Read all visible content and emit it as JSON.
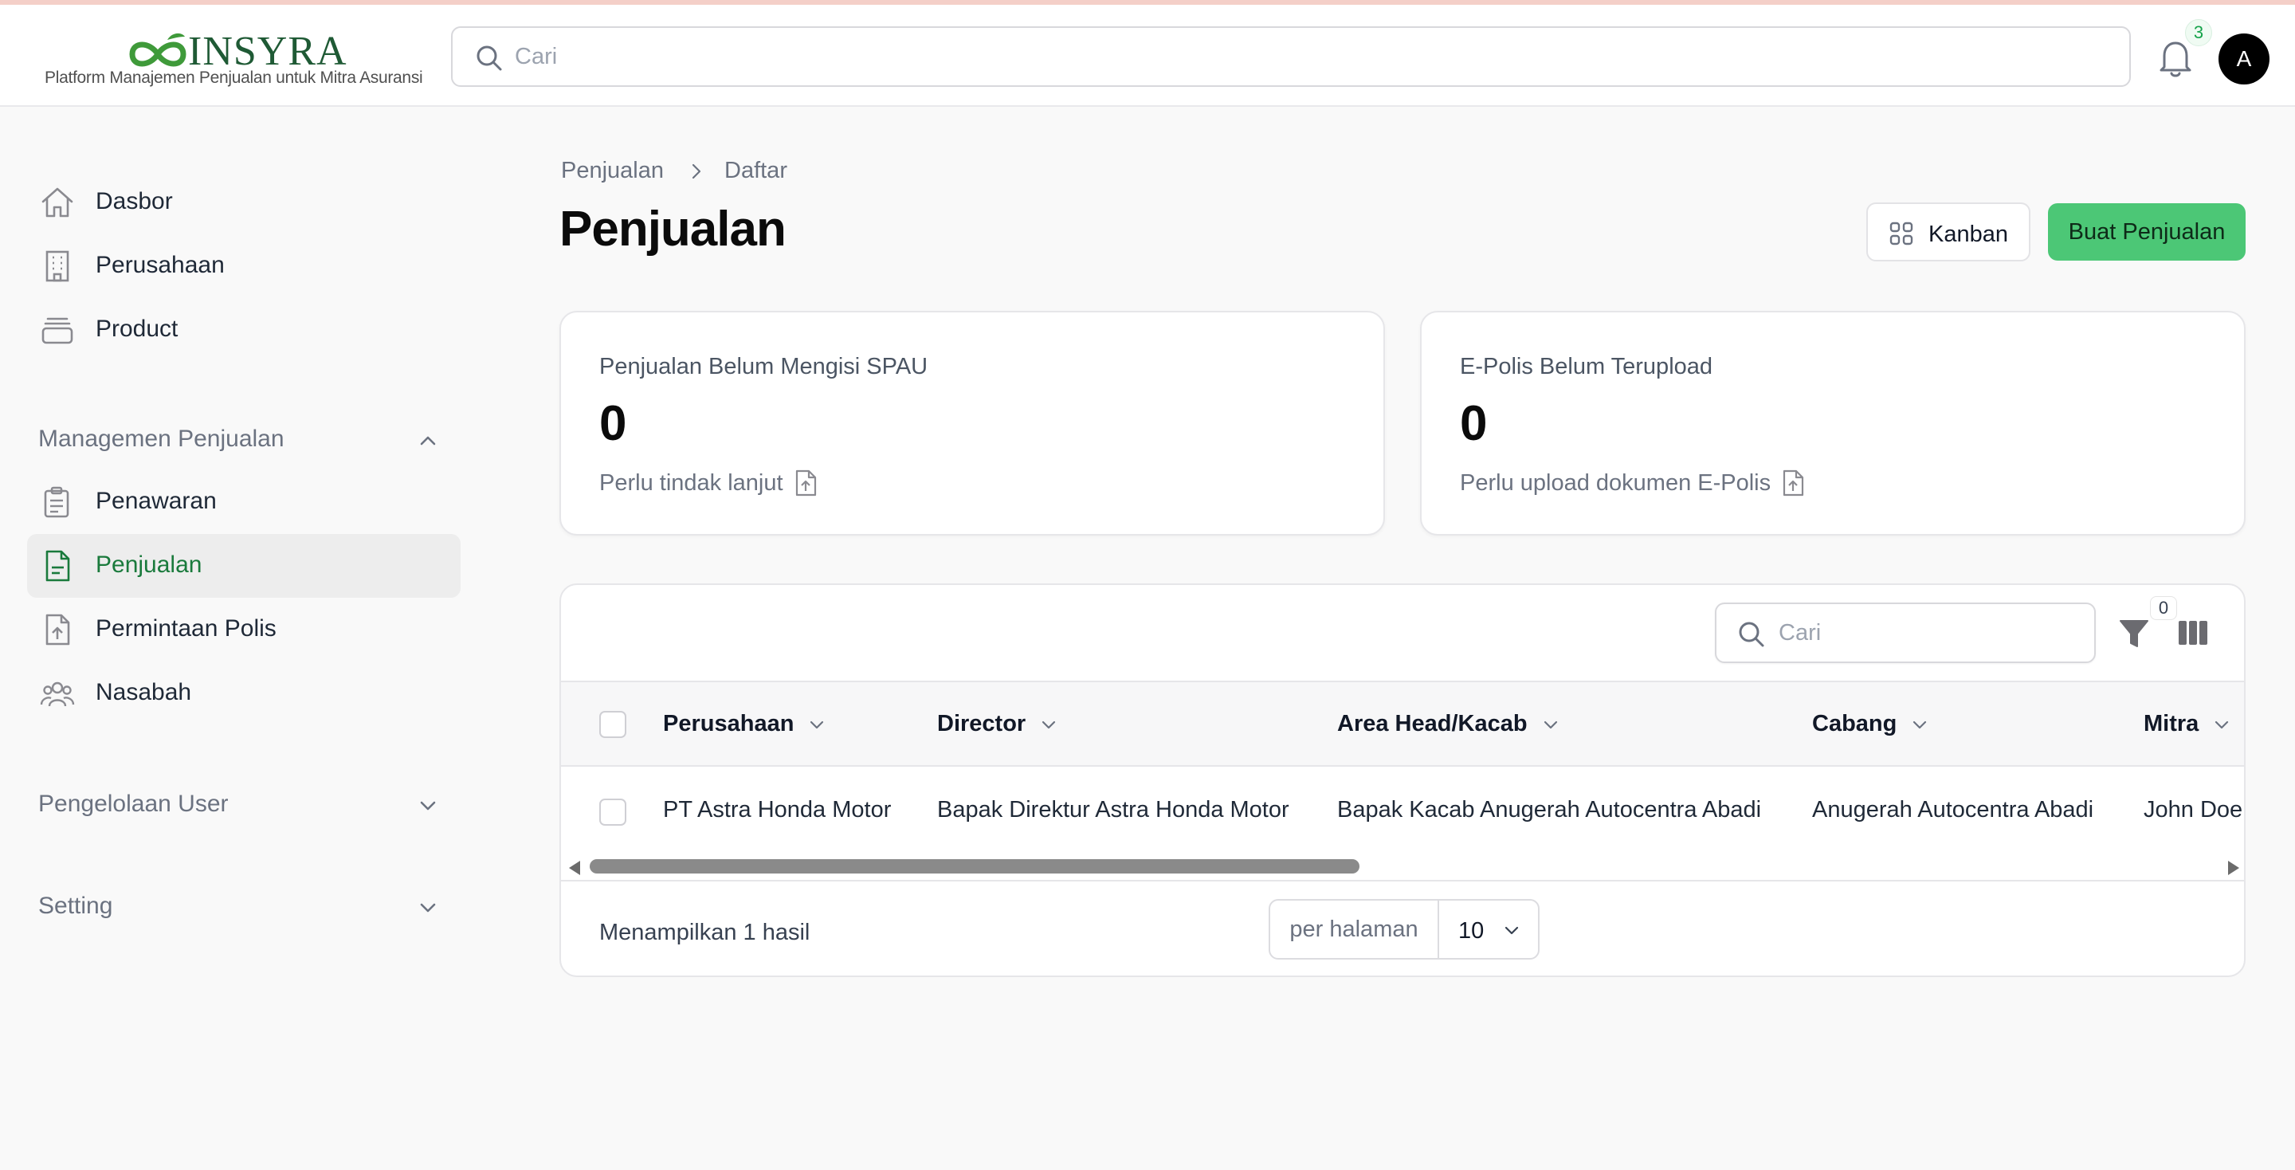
{
  "brand": {
    "name": "INSYRA",
    "tagline": "Platform Manajemen Penjualan untuk Mitra Asuransi",
    "color": "#1f5a35"
  },
  "top_search": {
    "placeholder": "Cari",
    "icon": "search-icon"
  },
  "notifications": {
    "count": "3",
    "icon": "bell-icon"
  },
  "user": {
    "avatar_initial": "A"
  },
  "sidebar": {
    "items": [
      {
        "label": "Dasbor",
        "icon": "home-icon"
      },
      {
        "label": "Perusahaan",
        "icon": "building-icon"
      },
      {
        "label": "Product",
        "icon": "archive-box-icon"
      }
    ],
    "groups": [
      {
        "label": "Managemen Penjualan",
        "expanded": true,
        "items": [
          {
            "label": "Penawaran",
            "icon": "clipboard-icon"
          },
          {
            "label": "Penjualan",
            "icon": "document-icon",
            "active": true
          },
          {
            "label": "Permintaan Polis",
            "icon": "document-upload-icon"
          },
          {
            "label": "Nasabah",
            "icon": "users-icon"
          }
        ]
      },
      {
        "label": "Pengelolaan User",
        "expanded": false
      },
      {
        "label": "Setting",
        "expanded": false
      }
    ]
  },
  "breadcrumb": [
    "Penjualan",
    "Daftar"
  ],
  "page_title": "Penjualan",
  "actions": {
    "kanban_label": "Kanban",
    "create_label": "Buat Penjualan",
    "accent_color": "#4cc776"
  },
  "stats": [
    {
      "title": "Penjualan Belum Mengisi SPAU",
      "value": "0",
      "note": "Perlu tindak lanjut"
    },
    {
      "title": "E-Polis Belum Terupload",
      "value": "0",
      "note": "Perlu upload dokumen E-Polis"
    }
  ],
  "table": {
    "search_placeholder": "Cari",
    "filter_count": "0",
    "columns": [
      "Perusahaan",
      "Director",
      "Area Head/Kacab",
      "Cabang",
      "Mitra"
    ],
    "rows": [
      [
        "PT Astra Honda Motor",
        "Bapak Direktur Astra Honda Motor",
        "Bapak Kacab Anugerah Autocentra Abadi",
        "Anugerah Autocentra Abadi",
        "John Doe"
      ]
    ],
    "result_text": "Menampilkan 1 hasil",
    "per_page_label": "per halaman",
    "per_page_value": "10"
  }
}
